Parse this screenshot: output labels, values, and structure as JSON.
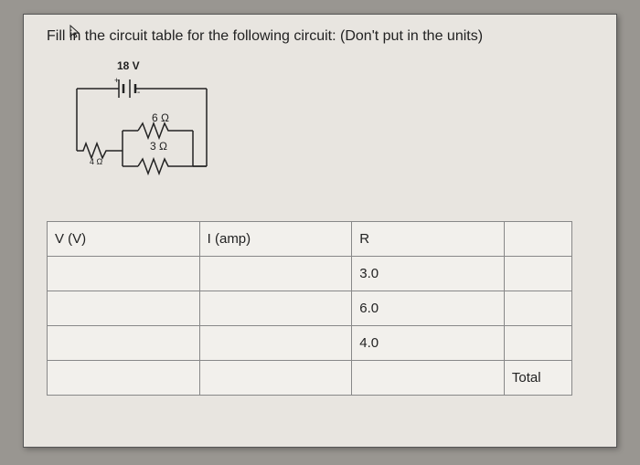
{
  "question": "Fill in the circuit table for the following circuit: (Don't put in the units)",
  "circuit": {
    "voltage_label": "18 V",
    "r1_label": "6 Ω",
    "r2_label": "3 Ω",
    "r3_label": "4 Ω"
  },
  "table": {
    "headers": {
      "c1": "V (V)",
      "c2": "I (amp)",
      "c3": "R"
    },
    "rows": [
      {
        "c1": "",
        "c2": "",
        "c3": "3.0",
        "c4": ""
      },
      {
        "c1": "",
        "c2": "",
        "c3": "6.0",
        "c4": ""
      },
      {
        "c1": "",
        "c2": "",
        "c3": "4.0",
        "c4": ""
      },
      {
        "c1": "",
        "c2": "",
        "c3": "",
        "c4": "Total"
      }
    ]
  }
}
